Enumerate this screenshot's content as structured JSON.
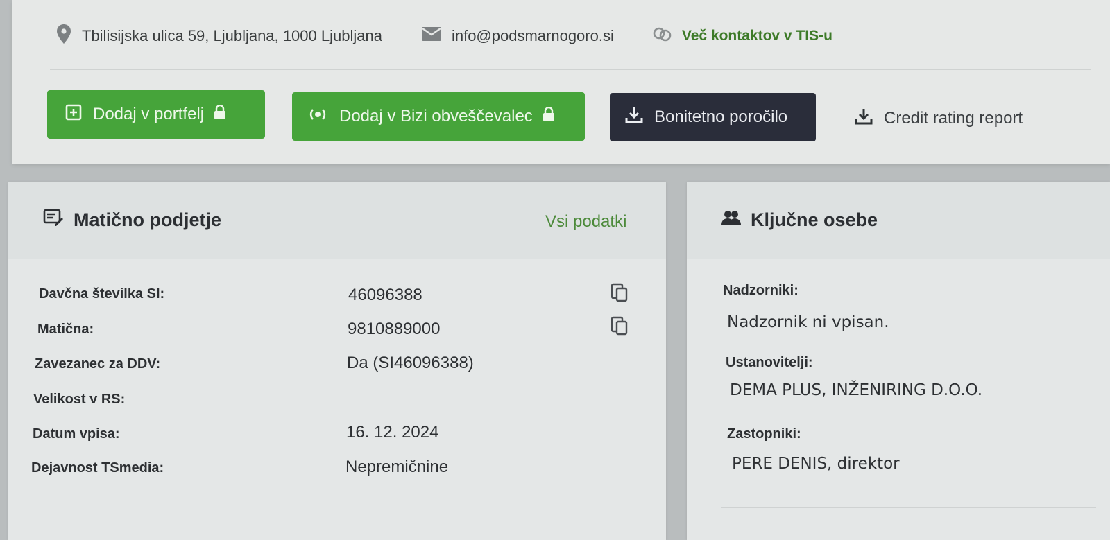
{
  "contacts": {
    "address": "Tbilisijska ulica 59, Ljubljana, 1000 Ljubljana",
    "email": "info@podsmarnogoro.si",
    "more_contacts": "Več kontaktov v TIS-u"
  },
  "actions": {
    "portfolio": "Dodaj v portfelj",
    "bizi": "Dodaj v Bizi obveščevalec",
    "credit_report": "Bonitetno poročilo",
    "credit_report_en": "Credit rating report"
  },
  "company": {
    "title": "Matično podjetje",
    "all_data": "Vsi podatki",
    "rows": [
      {
        "label": "Davčna številka SI:",
        "value": "46096388"
      },
      {
        "label": "Matična:",
        "value": "9810889000"
      },
      {
        "label": "Zavezanec za DDV:",
        "value": "Da (SI46096388)"
      },
      {
        "label": "Velikost v RS:",
        "value": ""
      },
      {
        "label": "Datum vpisa:",
        "value": "16. 12. 2024"
      },
      {
        "label": "Dejavnost TSmedia:",
        "value": "Nepremičnine"
      }
    ]
  },
  "people": {
    "title": "Ključne osebe",
    "supervisors_label": "Nadzorniki:",
    "supervisors_value": "Nadzornik ni vpisan.",
    "founders_label": "Ustanovitelji:",
    "founders_value": "DEMA PLUS, INŽENIRING D.O.O.",
    "representatives_label": "Zastopniki:",
    "representatives_value": "PERE DENIS, direktor"
  },
  "colors": {
    "green": "#46a43a",
    "dark": "#2a2d3a",
    "link_green": "#3d7a28"
  }
}
